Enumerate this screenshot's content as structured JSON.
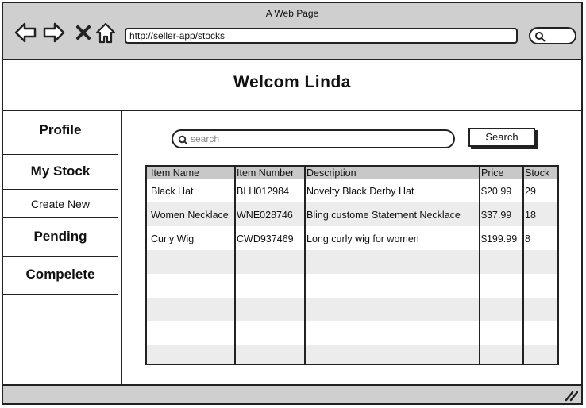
{
  "window": {
    "title": "A Web Page"
  },
  "browser": {
    "url": "http://seller-app/stocks",
    "icons": [
      "back-icon",
      "forward-icon",
      "close-icon",
      "home-icon",
      "search-icon"
    ]
  },
  "header": {
    "title": "Welcom Linda"
  },
  "sidebar": {
    "items": [
      {
        "label": "Profile"
      },
      {
        "label": "My Stock"
      },
      {
        "label": "Create New"
      },
      {
        "label": "Pending"
      },
      {
        "label": "Compelete"
      }
    ]
  },
  "search": {
    "placeholder": "search",
    "button_label": "Search"
  },
  "table": {
    "headers": [
      "Item Name",
      "Item Number",
      "Description",
      "Price",
      "Stock"
    ],
    "rows": [
      [
        "Black Hat",
        "BLH012984",
        "Novelty Black Derby Hat",
        "$20.99",
        "29"
      ],
      [
        "Women Necklace",
        "WNE028746",
        "Bling custome Statement Necklace",
        "$37.99",
        "18"
      ],
      [
        "Curly Wig",
        "CWD937469",
        "Long curly wig for women",
        "$199.99",
        "8"
      ]
    ]
  }
}
